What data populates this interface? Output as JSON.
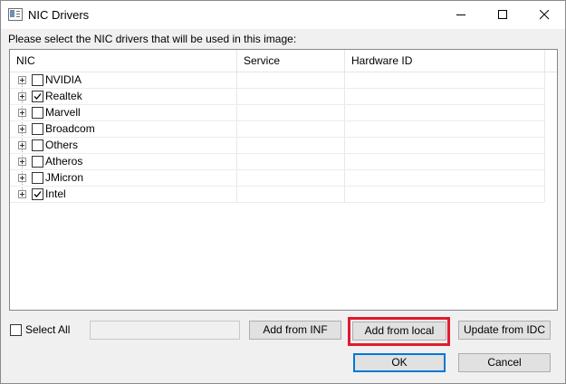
{
  "window": {
    "title": "NIC Drivers",
    "icons": {
      "app": "window-app-icon",
      "minimize": "minimize-icon",
      "maximize": "maximize-icon",
      "close": "close-icon"
    }
  },
  "prompt": "Please select the NIC drivers that will be used in this image:",
  "table": {
    "columns": [
      "NIC",
      "Service",
      "Hardware ID"
    ],
    "rows": [
      {
        "label": "NVIDIA",
        "checked": false
      },
      {
        "label": "Realtek",
        "checked": true
      },
      {
        "label": "Marvell",
        "checked": false
      },
      {
        "label": "Broadcom",
        "checked": false
      },
      {
        "label": "Others",
        "checked": false
      },
      {
        "label": "Atheros",
        "checked": false
      },
      {
        "label": "JMicron",
        "checked": false
      },
      {
        "label": "Intel",
        "checked": true
      }
    ]
  },
  "footer": {
    "select_all": {
      "label": "Select All",
      "checked": false
    },
    "path_value": "",
    "add_from_inf": "Add from INF",
    "add_from_local": "Add from local",
    "update_from_idc": "Update from IDC",
    "ok": "OK",
    "cancel": "Cancel",
    "highlight_color": "#e01b2e",
    "accent_color": "#0078d7"
  }
}
